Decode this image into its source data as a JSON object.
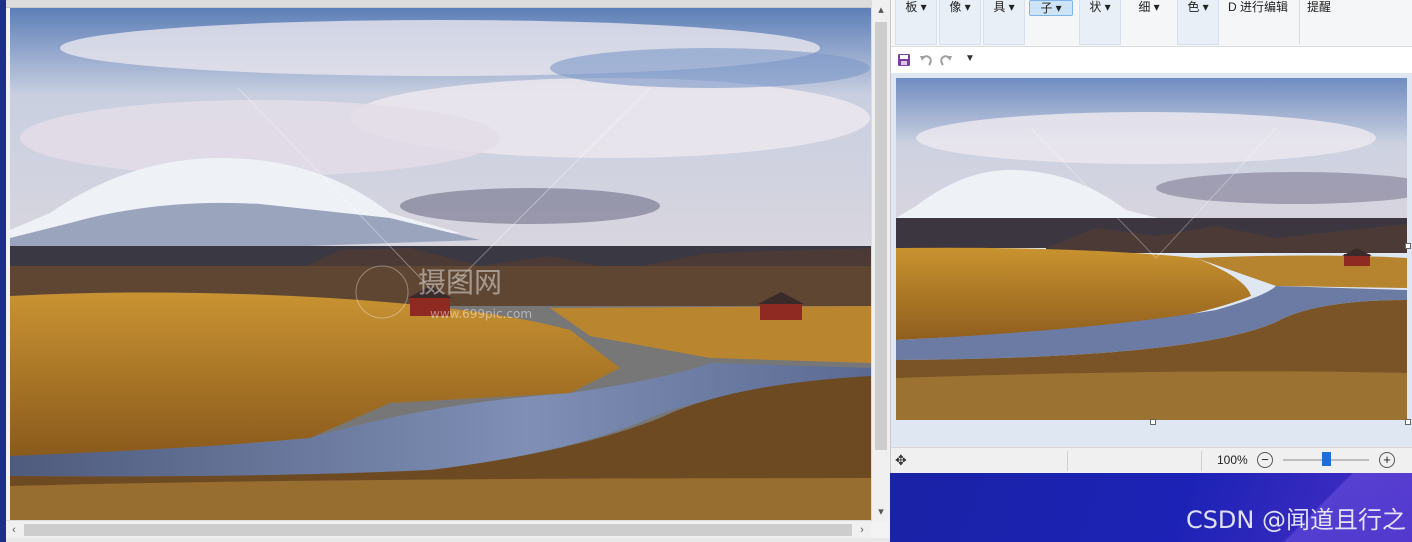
{
  "ribbon": {
    "groups": [
      {
        "label": "板"
      },
      {
        "label": "像"
      },
      {
        "label": "具"
      },
      {
        "label": "子"
      },
      {
        "label": "状"
      },
      {
        "label": "细"
      },
      {
        "label": "色"
      },
      {
        "label": "D 进行编辑"
      },
      {
        "label": "提醒"
      }
    ]
  },
  "quick_access": {
    "save": "save-icon",
    "undo": "undo-icon",
    "redo": "redo-icon",
    "customize": "dropdown-icon"
  },
  "status": {
    "move": "move-icon",
    "zoom_percent": "100%",
    "zoom_out": "−",
    "zoom_in": "+",
    "zoom_slider_level": 0.5
  },
  "desktop": {
    "watermark": "CSDN @闻道且行之"
  },
  "viewer": {
    "overlay_text": "摄图网",
    "overlay_subtext": "www.699pic.com"
  },
  "colors": {
    "accent": "#1e6fd9",
    "desktop_blue": "#1c22b5"
  }
}
